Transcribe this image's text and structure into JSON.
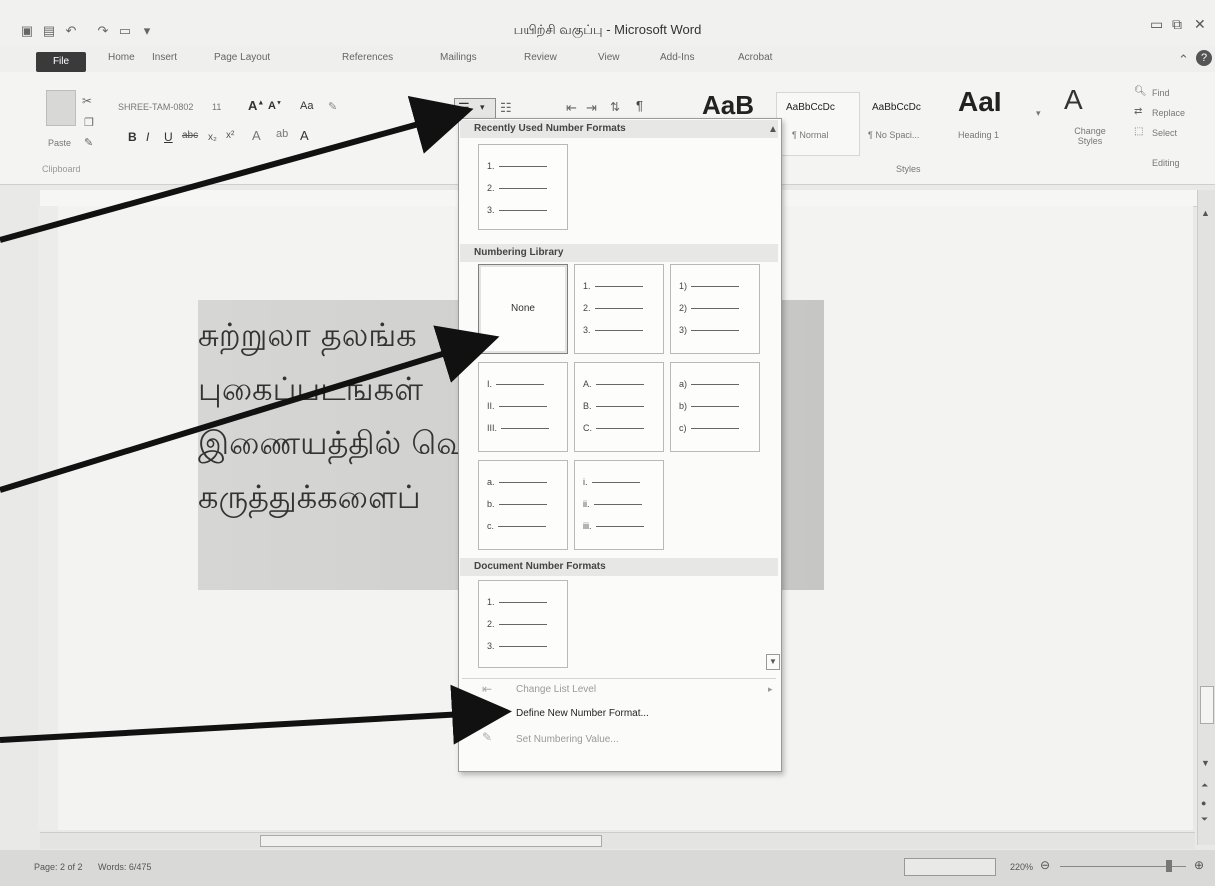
{
  "window": {
    "title_doc": "பயிற்சி வகுப்பு",
    "title_app": "Microsoft Word",
    "title_sep": "-"
  },
  "tabs": [
    "File",
    "Home",
    "Insert",
    "Page Layout",
    "References",
    "Mailings",
    "Review",
    "View",
    "Add-Ins",
    "Acrobat"
  ],
  "ribbon": {
    "paste_label": "Paste",
    "clipboard_label": "Clipboard",
    "font_name": "SHREE-TAM-0802",
    "font_size": "11",
    "styles": [
      {
        "sample": "AaBbCcDc",
        "name": "¶ Normal"
      },
      {
        "sample": "AaBbCcDc",
        "name": "¶ No Spaci..."
      },
      {
        "sample": "AaI",
        "name": "Heading 1"
      }
    ],
    "big_sample": "AaB",
    "change_styles_label": "Change Styles",
    "styles_group": "Styles",
    "editing": {
      "find": "Find",
      "replace": "Replace",
      "select": "Select",
      "group": "Editing"
    }
  },
  "document": {
    "lines": [
      "சுற்றுலா தலங்க",
      "புகைப்படங்கள்",
      "இணையத்தில் வெ",
      "கருத்துக்களைப்"
    ]
  },
  "dropdown": {
    "recent_header": "Recently Used Number Formats",
    "recent": [
      "1.",
      "2.",
      "3."
    ],
    "library_header": "Numbering Library",
    "library": [
      {
        "none": "None"
      },
      {
        "items": [
          "1.",
          "2.",
          "3."
        ]
      },
      {
        "items": [
          "1)",
          "2)",
          "3)"
        ]
      },
      {
        "items": [
          "I.",
          "II.",
          "III."
        ]
      },
      {
        "items": [
          "A.",
          "B.",
          "C."
        ]
      },
      {
        "items": [
          "a)",
          "b)",
          "c)"
        ]
      },
      {
        "items": [
          "a.",
          "b.",
          "c."
        ]
      },
      {
        "items": [
          "i.",
          "ii.",
          "iii."
        ]
      }
    ],
    "document_header": "Document Number Formats",
    "document": [
      "1.",
      "2.",
      "3."
    ],
    "change_list_level": "Change List Level",
    "define_new": "Define New Number Format...",
    "set_value": "Set Numbering Value..."
  },
  "statusbar": {
    "page": "Page: 2 of 2",
    "words": "Words: 6/475",
    "zoom": "220%"
  }
}
